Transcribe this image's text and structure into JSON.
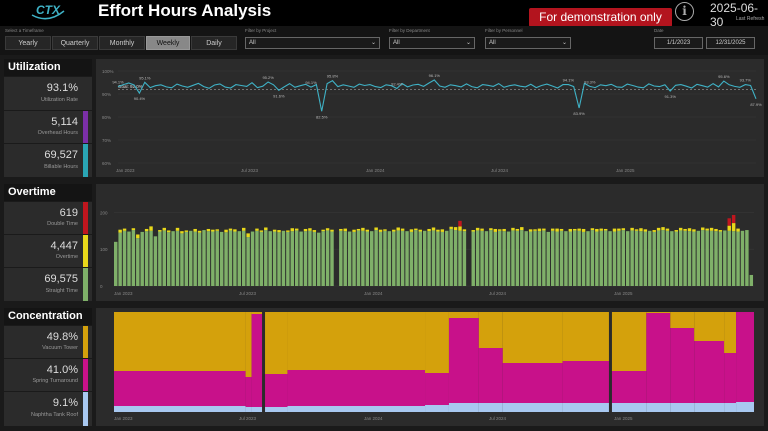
{
  "header": {
    "logo_text": "CTX",
    "title": "Effort Hours Analysis",
    "demo_banner": "For demonstration only",
    "info_icon": "info-icon",
    "date": "2025-06-30",
    "date_sub": "Last Refresh"
  },
  "filters": {
    "timeframe_label": "Select a Timeframe",
    "timeframes": [
      "Yearly",
      "Quarterly",
      "Monthly",
      "Weekly",
      "Daily"
    ],
    "active_timeframe": "Weekly",
    "project_label": "Filter by Project",
    "project_value": "All",
    "department_label": "Filter by Department",
    "department_value": "All",
    "personnel_label": "Filter by Personnel",
    "personnel_value": "All",
    "date_label": "Date",
    "date_start": "1/1/2023",
    "date_end": "12/31/2025"
  },
  "utilization": {
    "title": "Utilization",
    "kpis": [
      {
        "value": "93.1%",
        "label": "Utilization Rate",
        "color": ""
      },
      {
        "value": "5,114",
        "label": "Overhead Hours",
        "color": "#7b2fa8"
      },
      {
        "value": "69,527",
        "label": "Billable Hours",
        "color": "#2aa6b5"
      }
    ]
  },
  "overtime": {
    "title": "Overtime",
    "kpis": [
      {
        "value": "619",
        "label": "Double Time",
        "color": "#c0161e"
      },
      {
        "value": "4,447",
        "label": "Overtime",
        "color": "#e8d81a"
      },
      {
        "value": "69,575",
        "label": "Straight Time",
        "color": "#7fb069"
      }
    ]
  },
  "concentration": {
    "title": "Concentration",
    "kpis": [
      {
        "value": "49.8%",
        "label": "Vacuum Tower",
        "color": "#d4a10c"
      },
      {
        "value": "41.0%",
        "label": "Spring Turnaround",
        "color": "#c8118a"
      },
      {
        "value": "9.1%",
        "label": "Naphtha Tank Roof",
        "color": "#a8c8f0"
      }
    ]
  },
  "chart_data": [
    {
      "type": "line",
      "name": "utilization",
      "yticks": [
        "100%",
        "90%",
        "80%",
        "70%",
        "60%"
      ],
      "ylim": [
        60,
        100
      ],
      "xticks": [
        "Jan 2023",
        "Jul 2023",
        "Jan 2024",
        "Jul 2024",
        "Jan 2025"
      ],
      "goal_label": "Goal: 92.0%",
      "goal": 92,
      "color": "#3fb2c6",
      "values": [
        93.2,
        94.1,
        94.8,
        93.9,
        90.4,
        95.1,
        92.8,
        93.6,
        94.0,
        93.1,
        92.7,
        94.3,
        93.5,
        92.9,
        93.8,
        94.6,
        93.2,
        92.5,
        93.9,
        94.4,
        93.0,
        92.6,
        94.1,
        93.7,
        93.3,
        94.9,
        92.8,
        93.4,
        95.2,
        94.0,
        91.6,
        93.1,
        94.5,
        92.9,
        93.6,
        94.2,
        93.0,
        94.1,
        82.5,
        94.5,
        95.8,
        93.2,
        94.0,
        93.5,
        92.9,
        94.3,
        93.7,
        94.1,
        93.2,
        92.8,
        94.0,
        93.6,
        92.4,
        94.5,
        93.1,
        93.9,
        94.2,
        93.3,
        94.8,
        96.1,
        93.5,
        92.9,
        94.0,
        93.6,
        93.1,
        94.4,
        93.2,
        92.7,
        94.1,
        93.8,
        93.3,
        94.5,
        92.9,
        93.6,
        94.0,
        93.4,
        93.1,
        94.2,
        92.8,
        93.7,
        94.3,
        93.5,
        92.6,
        94.1,
        94.1,
        93.2,
        83.9,
        94.6,
        93.3,
        92.8,
        94.0,
        93.6,
        94.2,
        93.1,
        92.9,
        94.3,
        93.7,
        93.0,
        92.7,
        94.4,
        93.5,
        93.2,
        94.0,
        91.3,
        93.8,
        94.1,
        93.4,
        92.6,
        94.2,
        93.6,
        93.0,
        94.5,
        93.1,
        95.6,
        94.0,
        93.3,
        92.9,
        94.1,
        93.7,
        87.9
      ],
      "labels": [
        {
          "i": 0,
          "text": "94.1%"
        },
        {
          "i": 4,
          "text": "90.4%"
        },
        {
          "i": 5,
          "text": "95.1%"
        },
        {
          "i": 28,
          "text": "95.2%"
        },
        {
          "i": 30,
          "text": "91.6%"
        },
        {
          "i": 36,
          "text": "94.1%"
        },
        {
          "i": 38,
          "text": "82.5%"
        },
        {
          "i": 40,
          "text": "95.8%"
        },
        {
          "i": 52,
          "text": "92.4%"
        },
        {
          "i": 59,
          "text": "96.1%"
        },
        {
          "i": 84,
          "text": "94.1%"
        },
        {
          "i": 86,
          "text": "83.9%"
        },
        {
          "i": 88,
          "text": "93.3%"
        },
        {
          "i": 103,
          "text": "91.3%"
        },
        {
          "i": 113,
          "text": "95.6%"
        },
        {
          "i": 117,
          "text": "93.7%"
        },
        {
          "i": 119,
          "text": "87.9%"
        }
      ]
    },
    {
      "type": "bar",
      "name": "overtime",
      "stacked": true,
      "yticks": [
        "200",
        "100",
        "0"
      ],
      "ylim": [
        0,
        250
      ],
      "xticks": [
        "Jan 2023",
        "Jul 2023",
        "Jan 2024",
        "Jul 2024",
        "Jan 2025"
      ],
      "series_colors": {
        "straight": "#7fb069",
        "overtime": "#e8d81a",
        "double": "#c0161e"
      },
      "straight": [
        120,
        145,
        150,
        148,
        152,
        130,
        147,
        149,
        150,
        135,
        148,
        151,
        146,
        149,
        150,
        143,
        147,
        150,
        148,
        145,
        152,
        149,
        148,
        150,
        147,
        146,
        151,
        148,
        149,
        150,
        133,
        148,
        150,
        147,
        152,
        149,
        148,
        146,
        150,
        147,
        149,
        151,
        148,
        149,
        150,
        147,
        145,
        149,
        151,
        148,
        0,
        150,
        149,
        148,
        147,
        151,
        150,
        148,
        149,
        152,
        147,
        150,
        149,
        148,
        151,
        150,
        149,
        147,
        152,
        148,
        150,
        149,
        151,
        148,
        147,
        150,
        155,
        152,
        150,
        149,
        0,
        148,
        151,
        150,
        149,
        152,
        147,
        150,
        149,
        148,
        151,
        150,
        152,
        149,
        148,
        150,
        149,
        151,
        147,
        150,
        148,
        150,
        149,
        148,
        151,
        150,
        147,
        149,
        152,
        148,
        150,
        151,
        149,
        148,
        150,
        152,
        149,
        151,
        150,
        149,
        148,
        150,
        147,
        151,
        152,
        150,
        149,
        148,
        151,
        150,
        149,
        148,
        150,
        152,
        151,
        150,
        149,
        148,
        151,
        150,
        149,
        148,
        150,
        152,
        30
      ],
      "overtime": [
        0,
        8,
        6,
        0,
        5,
        10,
        0,
        6,
        12,
        0,
        4,
        7,
        5,
        0,
        8,
        6,
        4,
        0,
        7,
        5,
        0,
        6,
        5,
        4,
        0,
        7,
        5,
        6,
        0,
        8,
        10,
        0,
        6,
        4,
        7,
        0,
        5,
        6,
        0,
        4,
        8,
        5,
        0,
        6,
        7,
        5,
        0,
        4,
        6,
        5,
        0,
        5,
        7,
        0,
        6,
        4,
        8,
        5,
        0,
        7,
        6,
        4,
        0,
        5,
        8,
        6,
        0,
        7,
        4,
        5,
        0,
        6,
        8,
        5,
        7,
        0,
        6,
        8,
        12,
        5,
        0,
        4,
        7,
        6,
        0,
        5,
        8,
        4,
        6,
        0,
        7,
        5,
        8,
        0,
        6,
        4,
        7,
        5,
        0,
        6,
        8,
        5,
        0,
        7,
        4,
        6,
        8,
        0,
        5,
        7,
        6,
        4,
        0,
        8,
        6,
        5,
        0,
        7,
        4,
        8,
        6,
        0,
        5,
        7,
        8,
        6,
        0,
        4,
        7,
        5,
        8,
        6,
        0,
        7,
        5,
        8,
        6,
        4,
        0,
        14,
        22,
        8,
        0,
        0
      ],
      "double": [
        0,
        0,
        0,
        0,
        0,
        0,
        0,
        0,
        0,
        0,
        0,
        0,
        0,
        0,
        0,
        0,
        0,
        0,
        0,
        0,
        0,
        0,
        0,
        0,
        0,
        0,
        0,
        0,
        0,
        0,
        0,
        0,
        0,
        0,
        0,
        0,
        0,
        0,
        0,
        0,
        0,
        0,
        0,
        0,
        0,
        0,
        0,
        0,
        0,
        0,
        0,
        0,
        0,
        0,
        0,
        0,
        0,
        0,
        0,
        0,
        0,
        0,
        0,
        0,
        0,
        0,
        0,
        0,
        0,
        0,
        0,
        0,
        0,
        0,
        0,
        0,
        0,
        0,
        15,
        0,
        0,
        0,
        0,
        0,
        0,
        0,
        0,
        0,
        0,
        0,
        0,
        0,
        0,
        0,
        0,
        0,
        0,
        0,
        0,
        0,
        0,
        0,
        0,
        0,
        0,
        0,
        0,
        0,
        0,
        0,
        0,
        0,
        0,
        0,
        0,
        0,
        0,
        0,
        0,
        0,
        0,
        0,
        0,
        0,
        0,
        0,
        0,
        0,
        0,
        0,
        0,
        0,
        0,
        0,
        0,
        0,
        0,
        0,
        0,
        20,
        22,
        0,
        0,
        0
      ]
    },
    {
      "type": "area",
      "name": "concentration",
      "stacked": true,
      "normalized": true,
      "xticks": [
        "Jan 2023",
        "Jul 2023",
        "Jan 2024",
        "Jul 2024",
        "Jan 2025"
      ],
      "series_colors": {
        "naphtha": "#a8c8f0",
        "spring": "#c8118a",
        "vacuum": "#d4a10c"
      },
      "segments": [
        {
          "start": 0,
          "end": 44,
          "naphtha": 6,
          "spring": 35,
          "vacuum": 59
        },
        {
          "start": 44,
          "end": 46,
          "naphtha": 5,
          "spring": 30,
          "vacuum": 65
        },
        {
          "start": 46,
          "end": 50,
          "naphtha": 5,
          "spring": 93,
          "vacuum": 2
        },
        {
          "start": 50,
          "end": 58,
          "naphtha": 5,
          "spring": 33,
          "vacuum": 62
        },
        {
          "start": 58,
          "end": 104,
          "naphtha": 6,
          "spring": 36,
          "vacuum": 58
        },
        {
          "start": 104,
          "end": 112,
          "naphtha": 7,
          "spring": 32,
          "vacuum": 61
        },
        {
          "start": 112,
          "end": 122,
          "naphtha": 9,
          "spring": 85,
          "vacuum": 6
        },
        {
          "start": 122,
          "end": 130,
          "naphtha": 9,
          "spring": 55,
          "vacuum": 36
        },
        {
          "start": 130,
          "end": 150,
          "naphtha": 9,
          "spring": 40,
          "vacuum": 51
        },
        {
          "start": 150,
          "end": 166,
          "naphtha": 9,
          "spring": 42,
          "vacuum": 49
        },
        {
          "start": 166,
          "end": 178,
          "naphtha": 9,
          "spring": 32,
          "vacuum": 59
        },
        {
          "start": 178,
          "end": 186,
          "naphtha": 9,
          "spring": 90,
          "vacuum": 1
        },
        {
          "start": 186,
          "end": 194,
          "naphtha": 9,
          "spring": 75,
          "vacuum": 16
        },
        {
          "start": 194,
          "end": 204,
          "naphtha": 9,
          "spring": 62,
          "vacuum": 29
        },
        {
          "start": 204,
          "end": 208,
          "naphtha": 9,
          "spring": 50,
          "vacuum": 41
        },
        {
          "start": 208,
          "end": 214,
          "naphtha": 10,
          "spring": 90,
          "vacuum": 0
        }
      ]
    }
  ]
}
